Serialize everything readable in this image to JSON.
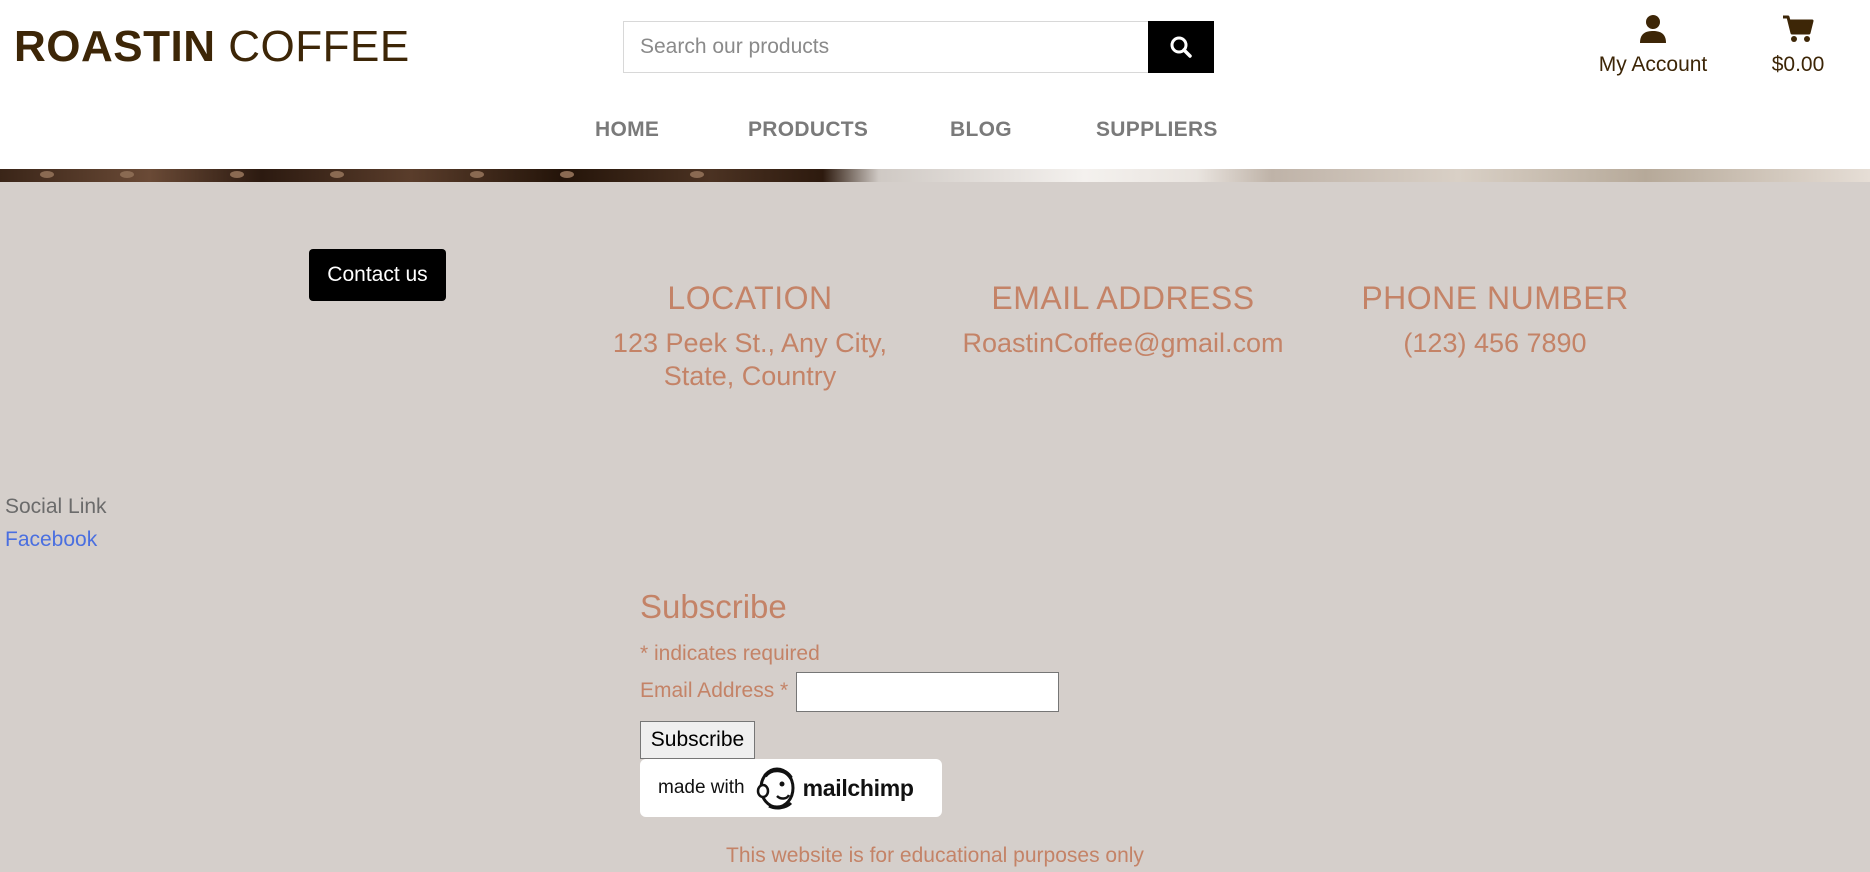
{
  "header": {
    "logo_bold": "ROASTIN",
    "logo_light": "COFFEE",
    "search_placeholder": "Search our products",
    "account_label": "My Account",
    "cart_total": "$0.00"
  },
  "nav": {
    "items": [
      "HOME",
      "PRODUCTS",
      "BLOG",
      "SUPPLIERS"
    ]
  },
  "contact": {
    "button_label": "Contact us",
    "location": {
      "heading": "LOCATION",
      "line1": "123 Peek St., Any City,",
      "line2": "State, Country"
    },
    "email": {
      "heading": "EMAIL ADDRESS",
      "value": "RoastinCoffee@gmail.com"
    },
    "phone": {
      "heading": "PHONE NUMBER",
      "value": "(123) 456 7890"
    }
  },
  "social": {
    "label": "Social Link",
    "facebook": "Facebook"
  },
  "subscribe": {
    "title": "Subscribe",
    "required_note": "* indicates required",
    "email_label": "Email Address *",
    "email_value": "",
    "button_label": "Subscribe",
    "badge_made_with": "made with",
    "badge_brand": "mailchimp"
  },
  "footer": {
    "note": "This website is for educational purposes only"
  },
  "colors": {
    "brand_brown": "#3d2607",
    "accent_copper": "#c48367",
    "page_bg": "#d5cfcb",
    "link_blue": "#4a6fe0"
  },
  "icons": [
    "search-icon",
    "user-icon",
    "cart-icon",
    "mailchimp-freddie-icon"
  ]
}
